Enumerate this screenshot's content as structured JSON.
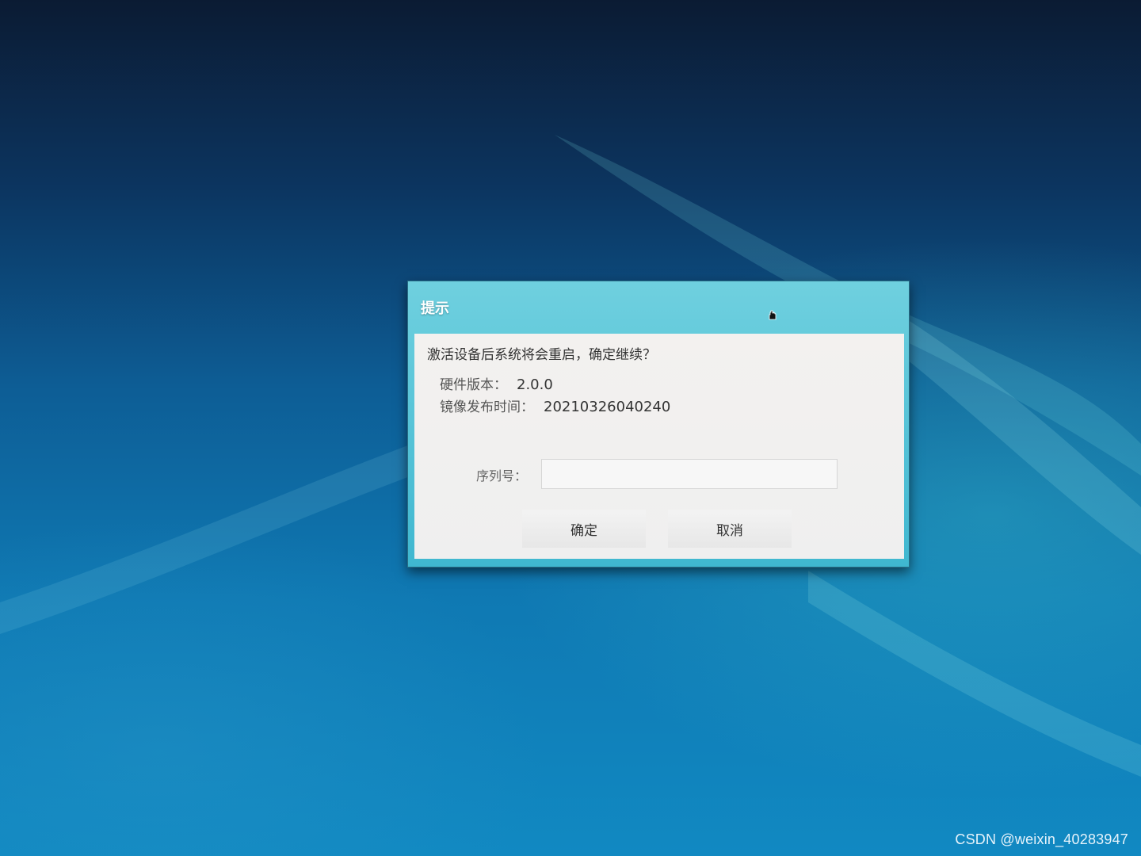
{
  "dialog": {
    "title": "提示",
    "message": "激活设备后系统将会重启，确定继续？",
    "info": {
      "hardware_label": "硬件版本：",
      "hardware_value": "2.0.0",
      "image_time_label": "镜像发布时间：",
      "image_time_value": "20210326040240"
    },
    "serial": {
      "label": "序列号：",
      "value": ""
    },
    "buttons": {
      "ok": "确定",
      "cancel": "取消"
    }
  },
  "watermark": "CSDN @weixin_40283947",
  "colors": {
    "titlebar": "#3fb7d0",
    "content_bg": "#f2f0ee",
    "desktop": "#0f79b3"
  },
  "icons": {
    "cursor": "hand-cursor-icon"
  }
}
